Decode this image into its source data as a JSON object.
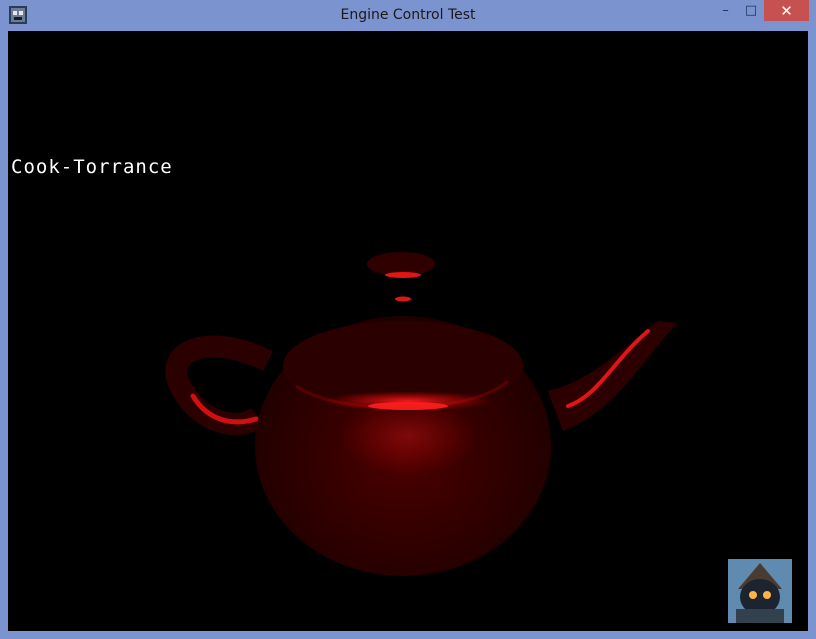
{
  "window": {
    "title": "Engine Control Test",
    "controls": {
      "minimize": "–",
      "maximize": "□",
      "close": "✕"
    }
  },
  "viewport": {
    "shader_label": "Cook-Torrance",
    "object": "teapot-icon",
    "avatar": "wizard-avatar-icon"
  },
  "colors": {
    "frame": "#7b93cf",
    "close": "#c75050",
    "background": "#000000",
    "teapot": "#3a0000",
    "specular": "#ff1a1a"
  }
}
